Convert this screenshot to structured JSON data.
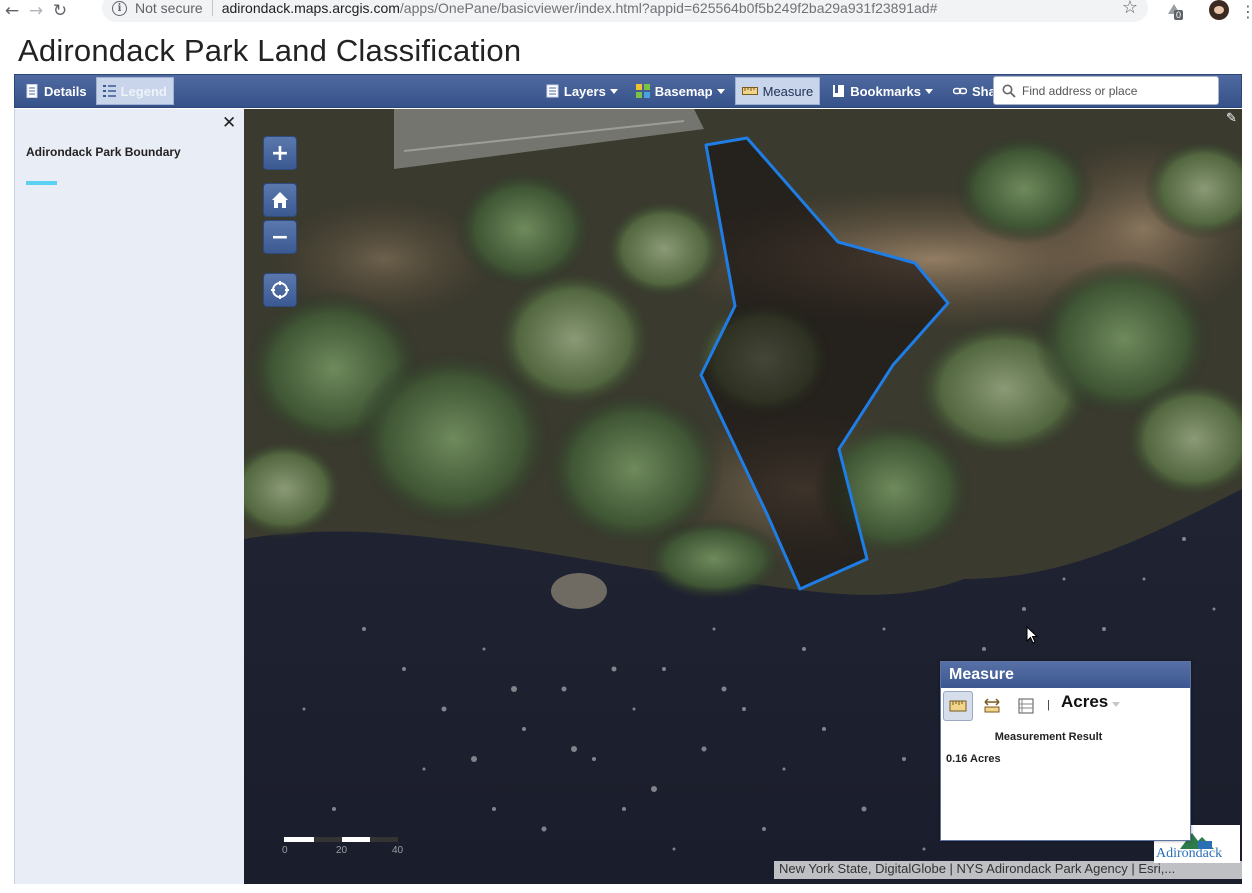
{
  "browser": {
    "security_label": "Not secure",
    "url_host": "adirondack.maps.arcgis.com",
    "url_path": "/apps/OnePane/basicviewer/index.html?appid=625564b0f5b249f2ba29a931f23891ad#",
    "extension_badge": "0"
  },
  "app": {
    "title": "Adirondack Park Land Classification"
  },
  "toolbar": {
    "details_label": "Details",
    "legend_label": "Legend",
    "layers_label": "Layers",
    "basemap_label": "Basemap",
    "measure_label": "Measure",
    "bookmarks_label": "Bookmarks",
    "share_label": "Share",
    "search_placeholder": "Find address or place"
  },
  "legend": {
    "layer_name": "Adirondack Park Boundary",
    "swatch_color": "#5ad1f2"
  },
  "map": {
    "scale_labels": [
      "0",
      "20",
      "40"
    ],
    "attribution": "New York State, DigitalGlobe | NYS Adirondack Park Agency | Esri,...",
    "logo_text": "Adirondack",
    "polygon_color": "#1f7de6"
  },
  "measure": {
    "title": "Measure",
    "unit": "Acres",
    "unit_separator": "|",
    "result_title": "Measurement Result",
    "result_value": "0.16 Acres"
  }
}
